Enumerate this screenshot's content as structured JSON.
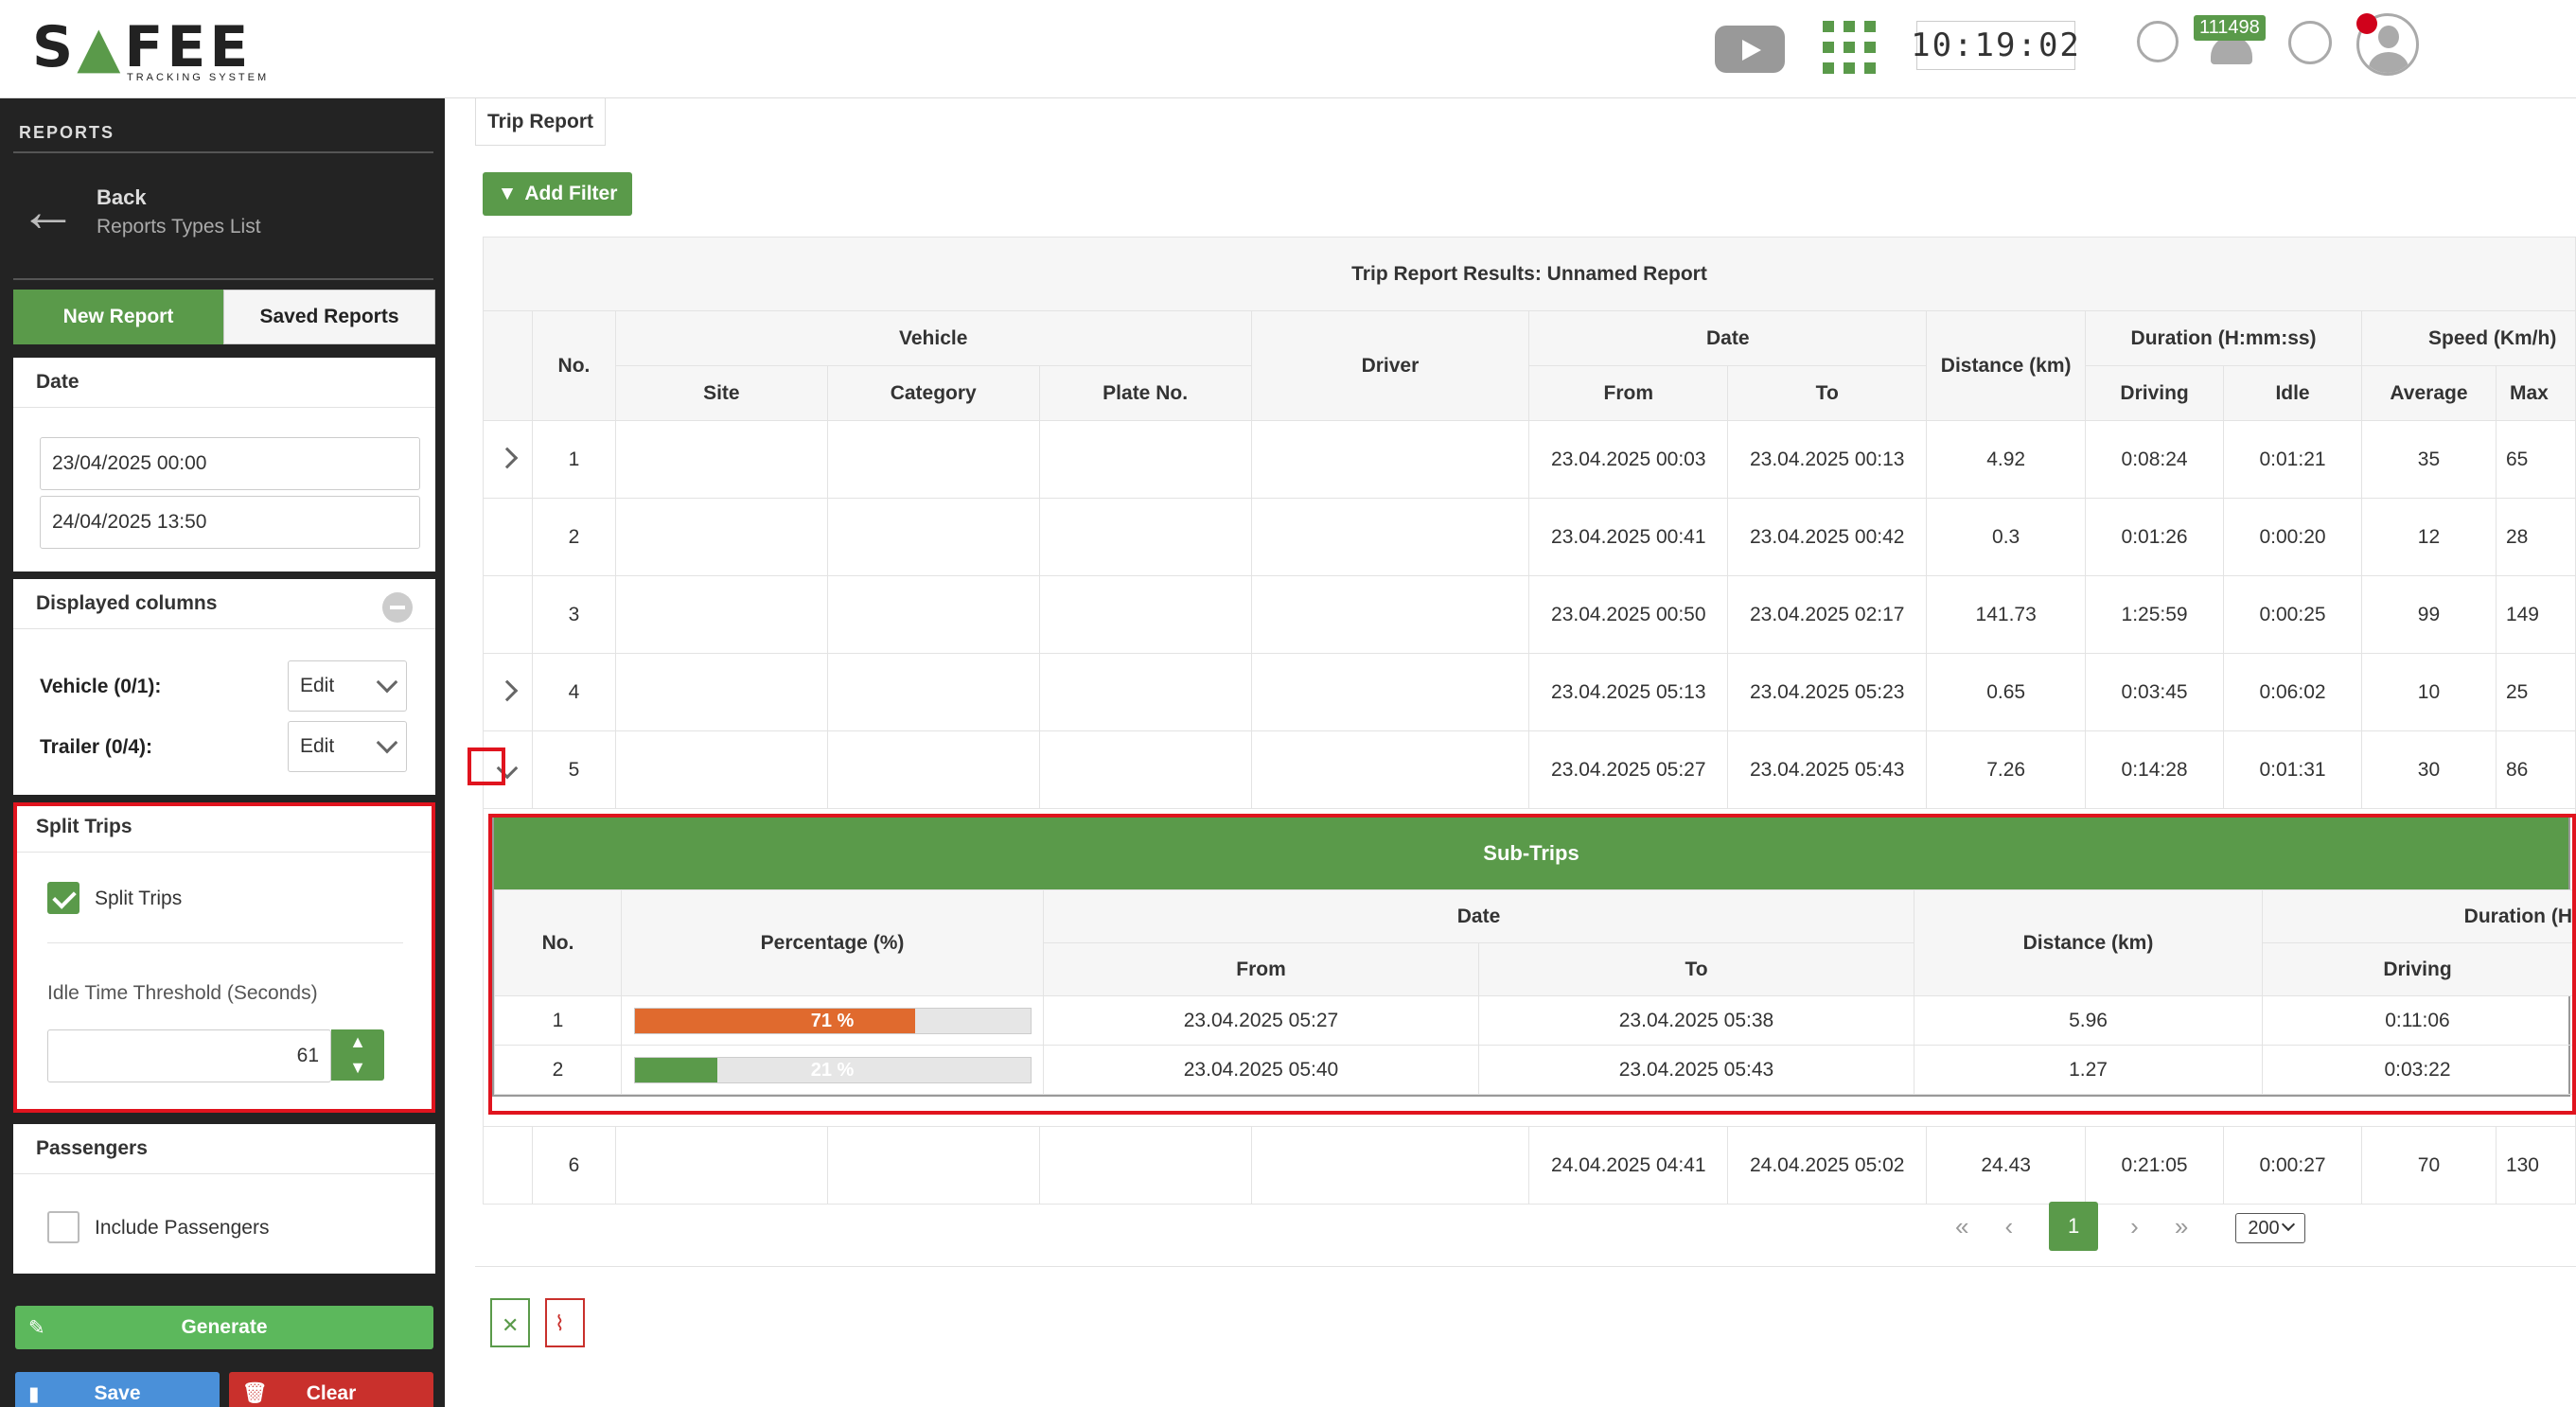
{
  "header": {
    "logo_main_1": "S",
    "logo_main_2": "FEE",
    "logo_sub": "TRACKING SYSTEM",
    "clock": "10:19:02",
    "notification_count": "111498",
    "icons": [
      "play-video-icon",
      "apps-grid-icon",
      "support-icon",
      "bell-icon",
      "globe-icon",
      "user-avatar-icon"
    ]
  },
  "sidebar": {
    "section_title": "REPORTS",
    "back_title": "Back",
    "back_subtitle": "Reports Types List",
    "tabs": [
      "New Report",
      "Saved Reports"
    ],
    "date": {
      "heading": "Date",
      "from": "23/04/2025 00:00",
      "to": "24/04/2025 13:50"
    },
    "displayed_columns": {
      "heading": "Displayed columns",
      "vehicle_label": "Vehicle (0/1):",
      "trailer_label": "Trailer (0/4):",
      "edit_label": "Edit"
    },
    "split_trips": {
      "heading": "Split Trips",
      "checkbox_label": "Split Trips",
      "checked": true,
      "threshold_label": "Idle Time Threshold (Seconds)",
      "threshold_value": "61"
    },
    "passengers": {
      "heading": "Passengers",
      "checkbox_label": "Include Passengers",
      "checked": false
    },
    "buttons": {
      "generate": "Generate",
      "save": "Save",
      "clear": "Clear"
    }
  },
  "main": {
    "page_tab": "Trip Report",
    "add_filter": "Add Filter",
    "results_title": "Trip Report Results: Unnamed Report",
    "headers": {
      "no": "No.",
      "vehicle": "Vehicle",
      "site": "Site",
      "category": "Category",
      "plate": "Plate No.",
      "driver": "Driver",
      "date": "Date",
      "from": "From",
      "to": "To",
      "distance": "Distance (km)",
      "duration": "Duration (H:mm:ss)",
      "driving": "Driving",
      "idle": "Idle",
      "speed": "Speed (Km/h)",
      "average": "Average",
      "max": "Max"
    },
    "rows": [
      {
        "no": "1",
        "from": "23.04.2025 00:03",
        "to": "23.04.2025 00:13",
        "distance": "4.92",
        "driving": "0:08:24",
        "idle": "0:01:21",
        "avg": "35",
        "max": "65"
      },
      {
        "no": "2",
        "from": "23.04.2025 00:41",
        "to": "23.04.2025 00:42",
        "distance": "0.3",
        "driving": "0:01:26",
        "idle": "0:00:20",
        "avg": "12",
        "max": "28"
      },
      {
        "no": "3",
        "from": "23.04.2025 00:50",
        "to": "23.04.2025 02:17",
        "distance": "141.73",
        "driving": "1:25:59",
        "idle": "0:00:25",
        "avg": "99",
        "max": "149"
      },
      {
        "no": "4",
        "from": "23.04.2025 05:13",
        "to": "23.04.2025 05:23",
        "distance": "0.65",
        "driving": "0:03:45",
        "idle": "0:06:02",
        "avg": "10",
        "max": "25"
      },
      {
        "no": "5",
        "from": "23.04.2025 05:27",
        "to": "23.04.2025 05:43",
        "distance": "7.26",
        "driving": "0:14:28",
        "idle": "0:01:31",
        "avg": "30",
        "max": "86"
      },
      {
        "no": "6",
        "from": "24.04.2025 04:41",
        "to": "24.04.2025 05:02",
        "distance": "24.43",
        "driving": "0:21:05",
        "idle": "0:00:27",
        "avg": "70",
        "max": "130"
      }
    ],
    "subtrips": {
      "title": "Sub-Trips",
      "headers": {
        "no": "No.",
        "percentage": "Percentage (%)",
        "date": "Date",
        "from": "From",
        "to": "To",
        "distance": "Distance (km)",
        "duration": "Duration (H",
        "driving": "Driving"
      },
      "rows": [
        {
          "no": "1",
          "percent": 71,
          "percent_label": "71 %",
          "color": "#e06a2e",
          "from": "23.04.2025 05:27",
          "to": "23.04.2025 05:38",
          "distance": "5.96",
          "driving": "0:11:06"
        },
        {
          "no": "2",
          "percent": 21,
          "percent_label": "21 %",
          "color": "#5a9a4a",
          "from": "23.04.2025 05:40",
          "to": "23.04.2025 05:43",
          "distance": "1.27",
          "driving": "0:03:22"
        }
      ]
    },
    "pagination": {
      "first": "«",
      "prev": "‹",
      "current": "1",
      "next": "›",
      "last": "»",
      "page_size": "200"
    },
    "exports": [
      "excel-export-icon",
      "pdf-export-icon"
    ]
  },
  "colors": {
    "brand_green": "#5a9a4a",
    "highlight_red": "#e0141e",
    "save_blue": "#4a90d9",
    "clear_red": "#c9302c"
  }
}
